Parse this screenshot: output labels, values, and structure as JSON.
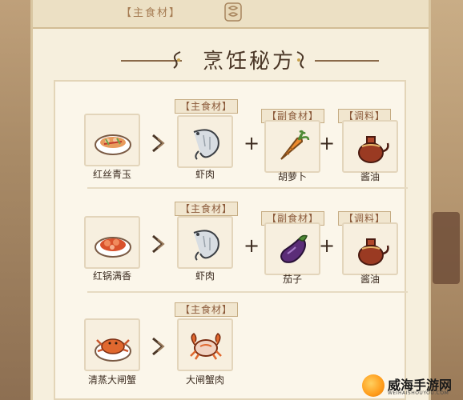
{
  "top_tab": {
    "label": "【主食材】"
  },
  "title": "烹饪秘方",
  "recipes": [
    {
      "dish": "红丝青玉",
      "main": {
        "tag": "主食材",
        "name": "虾肉"
      },
      "side": {
        "tag": "副食材",
        "name": "胡萝卜"
      },
      "seasoning": {
        "tag": "调料",
        "name": "酱油"
      }
    },
    {
      "dish": "红锅满香",
      "main": {
        "tag": "主食材",
        "name": "虾肉"
      },
      "side": {
        "tag": "副食材",
        "name": "茄子"
      },
      "seasoning": {
        "tag": "调料",
        "name": "酱油"
      }
    },
    {
      "dish": "清蒸大闸蟹",
      "main": {
        "tag": "主食材",
        "name": "大闸蟹肉"
      }
    }
  ],
  "plus_symbol": "+",
  "watermark": {
    "text": "威海手游网",
    "sub": "WEIHAISHOUYOU.COM"
  },
  "colors": {
    "paper": "#f6efdd",
    "tag_text": "#8b5a3a",
    "text": "#3c2c20"
  }
}
